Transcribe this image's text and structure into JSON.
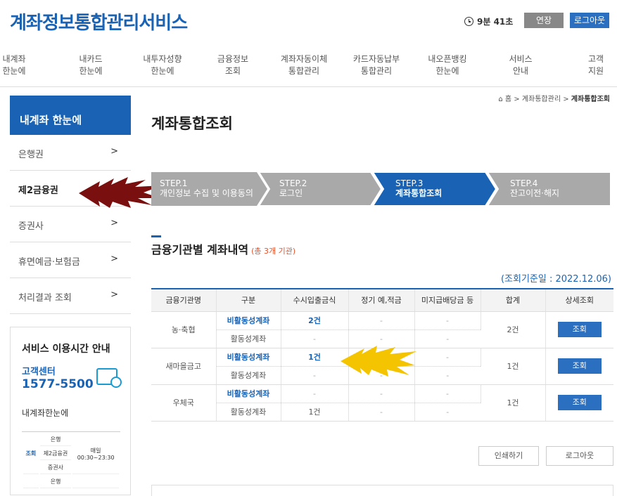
{
  "header": {
    "logo": "계좌정보통합관리서비스",
    "timer": "9분 41초",
    "extend_label": "연장",
    "logout_label": "로그아웃"
  },
  "gnb": [
    {
      "label": "내계좌\n한눈에"
    },
    {
      "label": "내카드\n한눈에"
    },
    {
      "label": "내투자성향\n한눈에"
    },
    {
      "label": "금융정보\n조회"
    },
    {
      "label": "계좌자동이체\n통합관리"
    },
    {
      "label": "카드자동납부\n통합관리"
    },
    {
      "label": "내오픈뱅킹\n한눈에"
    },
    {
      "label": "서비스\n안내"
    },
    {
      "label": "고객\n지원"
    }
  ],
  "sidebar": {
    "title": "내계좌 한눈에",
    "items": [
      {
        "label": "은행권",
        "chevron": ">"
      },
      {
        "label": "제2금융권",
        "chevron": ""
      },
      {
        "label": "증권사",
        "chevron": ">"
      },
      {
        "label": "휴면예금·보험금",
        "chevron": ">"
      },
      {
        "label": "처리결과 조회",
        "chevron": ">"
      }
    ],
    "info": {
      "title": "서비스 이용시간 안내",
      "cc_label": "고객센터",
      "cc_number": "1577-5500",
      "sub_title": "내계좌한눈에",
      "table": {
        "label": "조회",
        "rows": [
          "은행",
          "제2금융권",
          "증권사"
        ],
        "time": "매일\n00:30~23:30",
        "next_row": "은행"
      }
    }
  },
  "breadcrumb": {
    "home": "홈",
    "mid": "계좌통합관리",
    "current": "계좌통합조회",
    "sep": ">"
  },
  "page_title": "계좌통합조회",
  "steps": [
    {
      "num": "STEP.1",
      "label": "개인정보 수집 및 이용동의",
      "active": false
    },
    {
      "num": "STEP.2",
      "label": "로그인",
      "active": false
    },
    {
      "num": "STEP.3",
      "label": "계좌통합조회",
      "active": true
    },
    {
      "num": "STEP.4",
      "label": "잔고이전·해지",
      "active": false
    }
  ],
  "section": {
    "title": "금융기관별 계좌내역",
    "count": "(총 3개 기관)",
    "as_of": "(조회기준일 : 2022.12.06)"
  },
  "table": {
    "headers": [
      "금융기관명",
      "구분",
      "수시입출금식",
      "정기 예,적금",
      "미지급배당금 등",
      "합계",
      "상세조회"
    ],
    "groups": [
      {
        "name": "농·축협",
        "total": "2건",
        "button": "조회",
        "rows": [
          {
            "type": "비활동성계좌",
            "demand": "2건",
            "term": "-",
            "unpaid": "-"
          },
          {
            "type": "활동성계좌",
            "demand": "-",
            "term": "-",
            "unpaid": "-"
          }
        ]
      },
      {
        "name": "새마을금고",
        "total": "1건",
        "button": "조회",
        "rows": [
          {
            "type": "비활동성계좌",
            "demand": "1건",
            "term": "-",
            "unpaid": "-"
          },
          {
            "type": "활동성계좌",
            "demand": "-",
            "term": "-",
            "unpaid": "-"
          }
        ]
      },
      {
        "name": "우체국",
        "total": "1건",
        "button": "조회",
        "rows": [
          {
            "type": "비활동성계좌",
            "demand": "-",
            "term": "-",
            "unpaid": "-"
          },
          {
            "type": "활동성계좌",
            "demand": "1건",
            "term": "-",
            "unpaid": "-"
          }
        ]
      }
    ]
  },
  "actions": {
    "print_label": "인쇄하기",
    "logout_label": "로그아웃"
  },
  "colors": {
    "brand": "#1a63b4",
    "step_active": "#1a63b4",
    "step_inactive": "#a9a9a9",
    "annotation_red": "#7a0f0f",
    "annotation_yellow": "#f5c400"
  }
}
